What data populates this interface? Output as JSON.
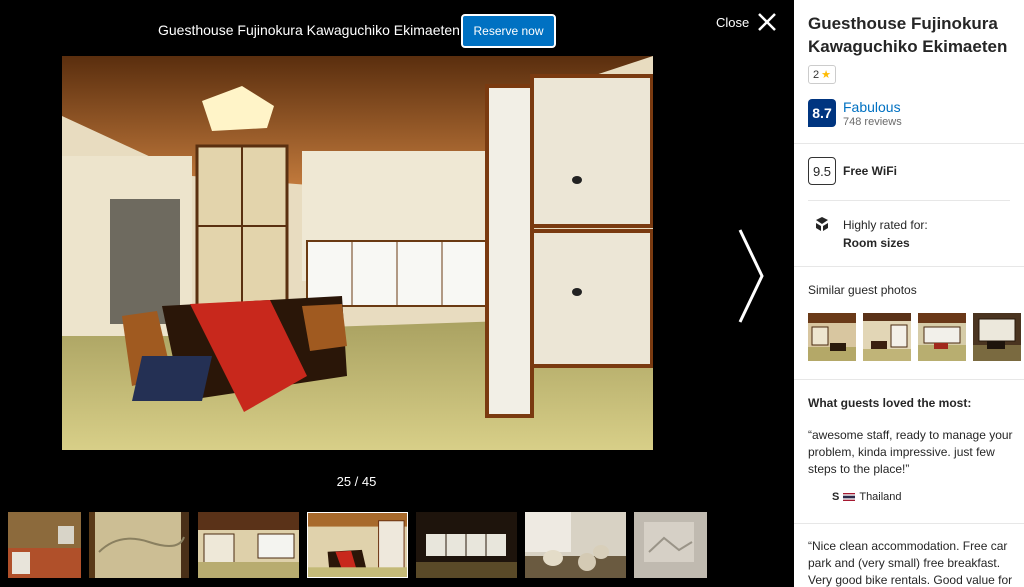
{
  "gallery": {
    "title": "Guesthouse Fujinokura Kawaguchiko Ekimaeten",
    "reserve_label": "Reserve now",
    "close_label": "Close",
    "counter": "25 / 45",
    "icons": {
      "close": "close-icon",
      "next": "chevron-right-icon"
    }
  },
  "panel": {
    "name": "Guesthouse Fujinokura Kawaguchiko Ekimaeten",
    "stars": "2",
    "score": "8.7",
    "score_word": "Fabulous",
    "reviews": "748 reviews",
    "wifi_score": "9.5",
    "wifi_label": "Free WiFi",
    "rated_label": "Highly rated for:",
    "rated_value": "Room sizes",
    "similar_title": "Similar guest photos",
    "loved_title": "What guests loved the most:",
    "quote1": "“awesome staff, ready to manage your problem, kinda impressive. just few steps to the place!”",
    "reviewer_initial": "S",
    "reviewer_country": "Thailand",
    "quote2": "“Nice clean accommodation. Free car park and (very small) free breakfast. Very good bike rentals. Good value for"
  },
  "colors": {
    "brand_blue": "#0071c2",
    "score_navy": "#003580",
    "star_yellow": "#febb02"
  }
}
